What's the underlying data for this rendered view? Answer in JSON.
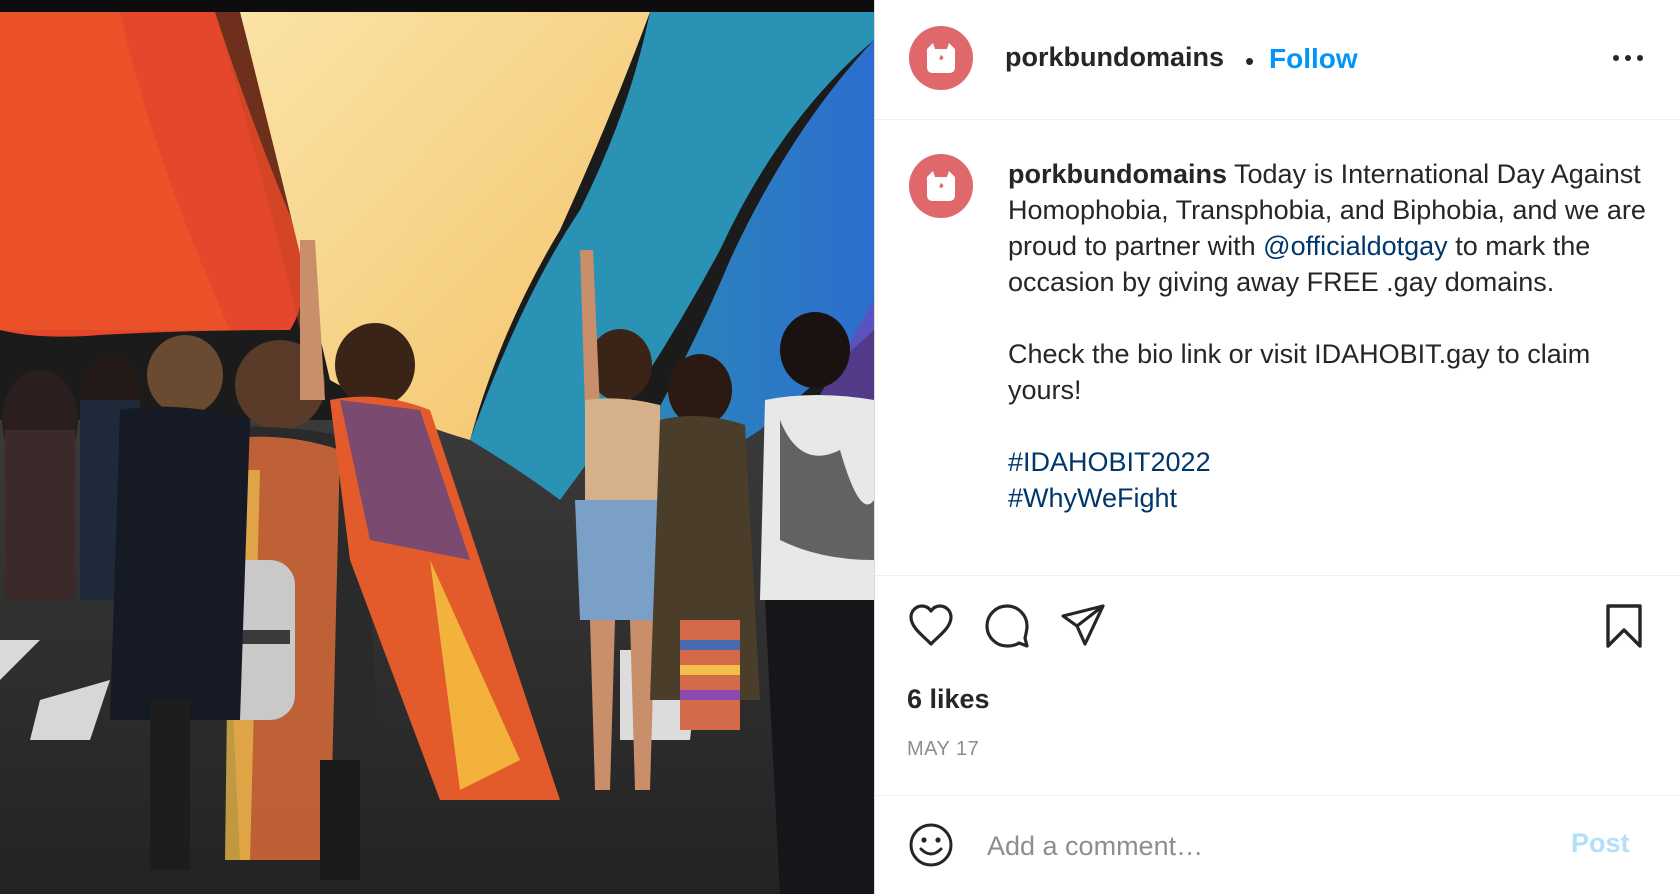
{
  "header": {
    "username": "porkbundomains",
    "separator": "•",
    "follow_label": "Follow",
    "avatar_icon": "pig-logo-icon",
    "more_icon": "more-options-icon"
  },
  "caption": {
    "username": "porkbundomains",
    "text_1": " Today is International Day Against Homophobia, Transphobia, and Biphobia, and we are proud to partner with ",
    "mention": "@officialdotgay",
    "text_2": " to mark the occasion by giving away FREE .gay domains.",
    "paragraph_2": "Check the bio link or visit IDAHOBIT.gay to claim yours!",
    "hashtag_1": "#IDAHOBIT2022",
    "hashtag_2": "#WhyWeFight"
  },
  "actions": {
    "like_icon": "heart-icon",
    "comment_icon": "comment-icon",
    "share_icon": "share-icon",
    "save_icon": "bookmark-icon",
    "likes": "6 likes",
    "date": "MAY 17"
  },
  "comment_bar": {
    "emoji_icon": "emoji-icon",
    "placeholder": "Add a comment…",
    "post_label": "Post"
  },
  "colors": {
    "follow": "#0095f6",
    "mention": "#00376b",
    "post_disabled": "#b2dffc",
    "avatar": "#e0686a"
  }
}
